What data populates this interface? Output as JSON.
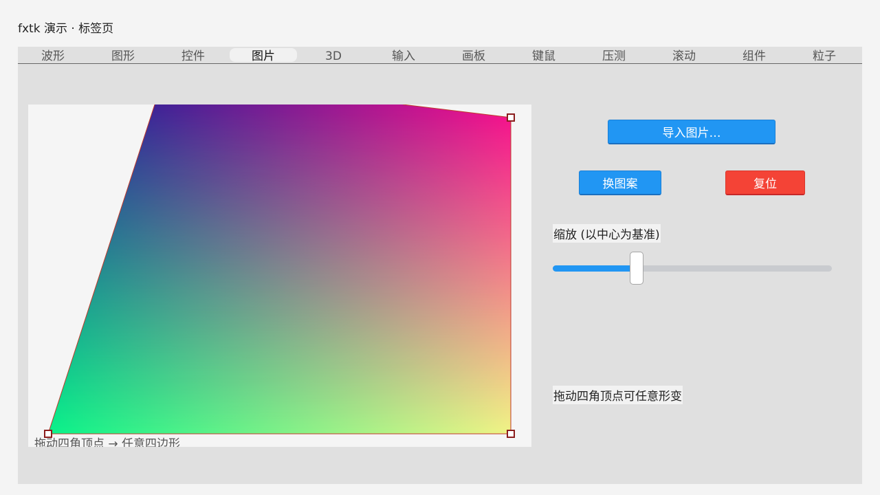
{
  "window": {
    "title": "fxtk 演示 · 标签页"
  },
  "tabs": [
    {
      "label": "波形",
      "active": false
    },
    {
      "label": "图形",
      "active": false
    },
    {
      "label": "控件",
      "active": false
    },
    {
      "label": "图片",
      "active": true
    },
    {
      "label": "3D",
      "active": false
    },
    {
      "label": "输入",
      "active": false
    },
    {
      "label": "画板",
      "active": false
    },
    {
      "label": "键鼠",
      "active": false
    },
    {
      "label": "压测",
      "active": false
    },
    {
      "label": "滚动",
      "active": false
    },
    {
      "label": "组件",
      "active": false
    },
    {
      "label": "粒子",
      "active": false
    }
  ],
  "canvas": {
    "hint": "拖动四角顶点 → 任意四边形",
    "gradient_colors": {
      "top_left": "#002a9a",
      "top_right": "#ff0a8c",
      "bottom_left": "#00fa8a",
      "bottom_right": "#fbfd86"
    },
    "outline_color": "#c0392b",
    "handle_color": "#8a1c1c"
  },
  "controls": {
    "import_label": "导入图片…",
    "change_pattern_label": "换图案",
    "reset_label": "复位",
    "zoom_label": "缩放 (以中心为基准)",
    "zoom_value_fraction": 0.3,
    "deform_hint": "拖动四角顶点可任意形变"
  },
  "colors": {
    "accent_blue": "#2196f3",
    "danger_red": "#f44336"
  }
}
